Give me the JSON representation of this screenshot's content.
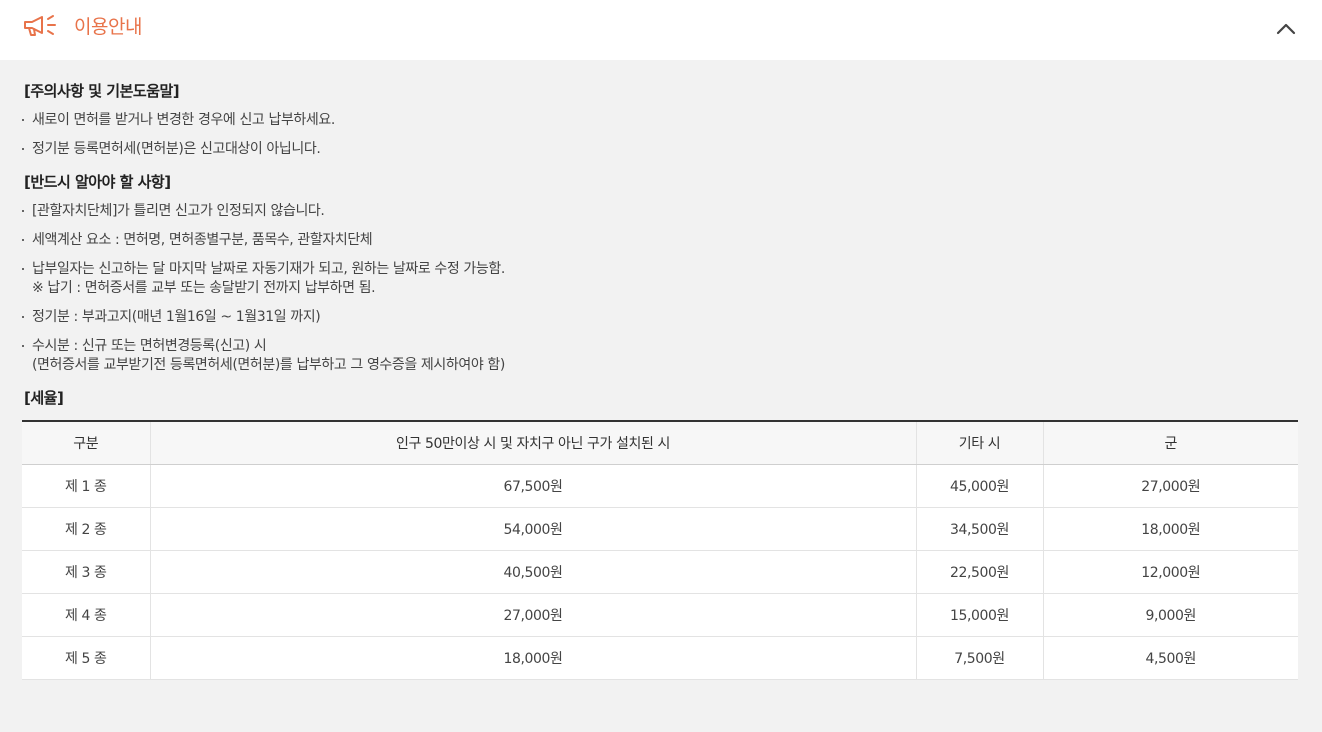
{
  "header": {
    "title": "이용안내",
    "icon": "megaphone-icon",
    "toggle_icon": "chevron-up-icon",
    "accent_color": "#e8734a"
  },
  "sections": [
    {
      "heading": "[주의사항 및 기본도움말]",
      "items": [
        {
          "text": "새로이 면허를 받거나 변경한 경우에 신고 납부하세요."
        },
        {
          "text": "정기분 등록면허세(면허분)은 신고대상이 아닙니다."
        }
      ]
    },
    {
      "heading": "[반드시 알아야 할 사항]",
      "items": [
        {
          "text": "[관할자치단체]가 틀리면 신고가 인정되지 않습니다."
        },
        {
          "text": "세액계산 요소 : 면허명, 면허종별구분, 품목수, 관할자치단체"
        },
        {
          "text": "납부일자는 신고하는 달 마지막 날짜로 자동기재가 되고, 원하는 날짜로 수정 가능함.",
          "sub": "※ 납기 : 면허증서를 교부 또는 송달받기 전까지 납부하면 됨."
        },
        {
          "text": "정기분 : 부과고지(매년 1월16일 ~ 1월31일 까지)"
        },
        {
          "text": "수시분 : 신규 또는 면허변경등록(신고) 시",
          "sub": "(면허증서를 교부받기전 등록면허세(면허분)를 납부하고 그 영수증을 제시하여야 함)"
        }
      ]
    }
  ],
  "rates": {
    "heading": "[세율]",
    "columns": [
      "구분",
      "인구 50만이상 시 및 자치구 아닌 구가 설치된 시",
      "기타 시",
      "군"
    ],
    "rows": [
      [
        "제 1 종",
        "67,500원",
        "45,000원",
        "27,000원"
      ],
      [
        "제 2 종",
        "54,000원",
        "34,500원",
        "18,000원"
      ],
      [
        "제 3 종",
        "40,500원",
        "22,500원",
        "12,000원"
      ],
      [
        "제 4 종",
        "27,000원",
        "15,000원",
        "9,000원"
      ],
      [
        "제 5 종",
        "18,000원",
        "7,500원",
        "4,500원"
      ]
    ]
  }
}
